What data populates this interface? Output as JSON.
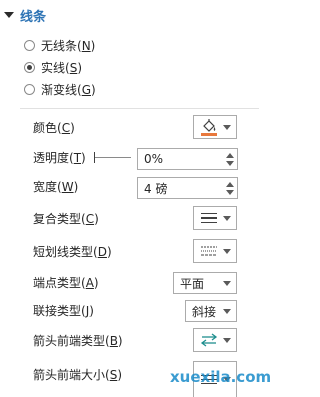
{
  "section": {
    "title": "线条"
  },
  "fill_options": [
    {
      "label": "无线条(",
      "key": "N",
      "end": ")",
      "checked": false
    },
    {
      "label": "实线(",
      "key": "S",
      "end": ")",
      "checked": true
    },
    {
      "label": "渐变线(",
      "key": "G",
      "end": ")",
      "checked": false
    }
  ],
  "color": {
    "label": "颜色(",
    "key": "C",
    "end": ")",
    "icon": "paint-bucket-icon",
    "accent": "#e8783c"
  },
  "transparency": {
    "label": "透明度(",
    "key": "T",
    "end": ")",
    "value": "0%"
  },
  "width": {
    "label": "宽度(",
    "key": "W",
    "end": ")",
    "value": "4 磅"
  },
  "compound": {
    "label": "复合类型(",
    "key": "C",
    "end": ")",
    "icon": "compound-lines-icon"
  },
  "dash": {
    "label": "短划线类型(",
    "key": "D",
    "end": ")",
    "icon": "dash-lines-icon"
  },
  "cap": {
    "label": "端点类型(",
    "key": "A",
    "end": ")",
    "value": "平面"
  },
  "join": {
    "label": "联接类型(",
    "key": "J",
    "end": ")",
    "value": "斜接"
  },
  "arrow_begin_type": {
    "label": "箭头前端类型(",
    "key": "B",
    "end": ")",
    "icon": "double-arrow-icon"
  },
  "arrow_begin_size": {
    "label": "箭头前端大小(",
    "key": "S",
    "end": ")",
    "icon": "arrow-size-lines-icon"
  },
  "watermark": "xuexila.com"
}
